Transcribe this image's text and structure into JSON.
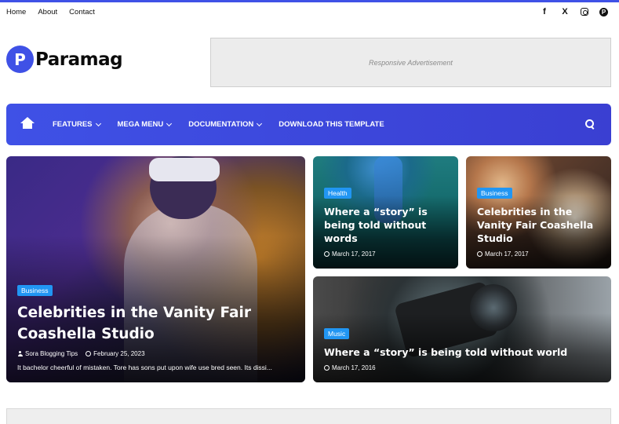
{
  "topbar": {
    "links": [
      "Home",
      "About",
      "Contact"
    ],
    "social": [
      "f",
      "X",
      "instagram",
      "P"
    ]
  },
  "logo": {
    "mark": "P",
    "name": "Paramag"
  },
  "ad": {
    "text": "Responsive Advertisement"
  },
  "nav": {
    "items": [
      {
        "label": "FEATURES",
        "dropdown": true
      },
      {
        "label": "MEGA MENU",
        "dropdown": true
      },
      {
        "label": "DOCUMENTATION",
        "dropdown": true
      },
      {
        "label": "DOWNLOAD THIS TEMPLATE",
        "dropdown": false
      }
    ]
  },
  "cards": [
    {
      "category": "Business",
      "title": "Celebrities in the Vanity Fair Coashella Studio",
      "author": "Sora Blogging Tips",
      "date": "February 25, 2023",
      "excerpt": "It bachelor cheerful of mistaken. Tore has sons put upon wife use bred seen. Its dissi..."
    },
    {
      "category": "Health",
      "title": "Where a “story” is being told without words",
      "date": "March 17, 2017"
    },
    {
      "category": "Business",
      "title": "Celebrities in the Vanity Fair Coashella Studio",
      "date": "March 17, 2017"
    },
    {
      "category": "Music",
      "title": "Where a “story” is being told without world",
      "date": "March 17, 2016"
    }
  ],
  "colors": {
    "accent": "#3f51e6",
    "badge": "#2196f3"
  }
}
